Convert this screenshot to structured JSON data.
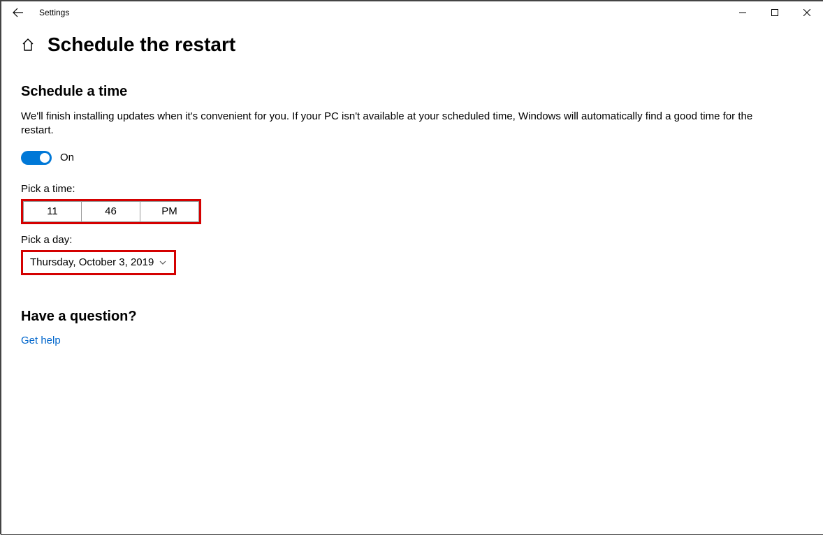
{
  "titlebar": {
    "app_name": "Settings"
  },
  "page": {
    "title": "Schedule the restart"
  },
  "schedule": {
    "heading": "Schedule a time",
    "description": "We'll finish installing updates when it's convenient for you. If your PC isn't available at your scheduled time, Windows will automatically find a good time for the restart.",
    "toggle_state_label": "On",
    "toggle_on": true,
    "pick_time_label": "Pick a time:",
    "time": {
      "hour": "11",
      "minute": "46",
      "period": "PM"
    },
    "pick_day_label": "Pick a day:",
    "day": "Thursday, October 3, 2019"
  },
  "help": {
    "heading": "Have a question?",
    "link_label": "Get help"
  }
}
